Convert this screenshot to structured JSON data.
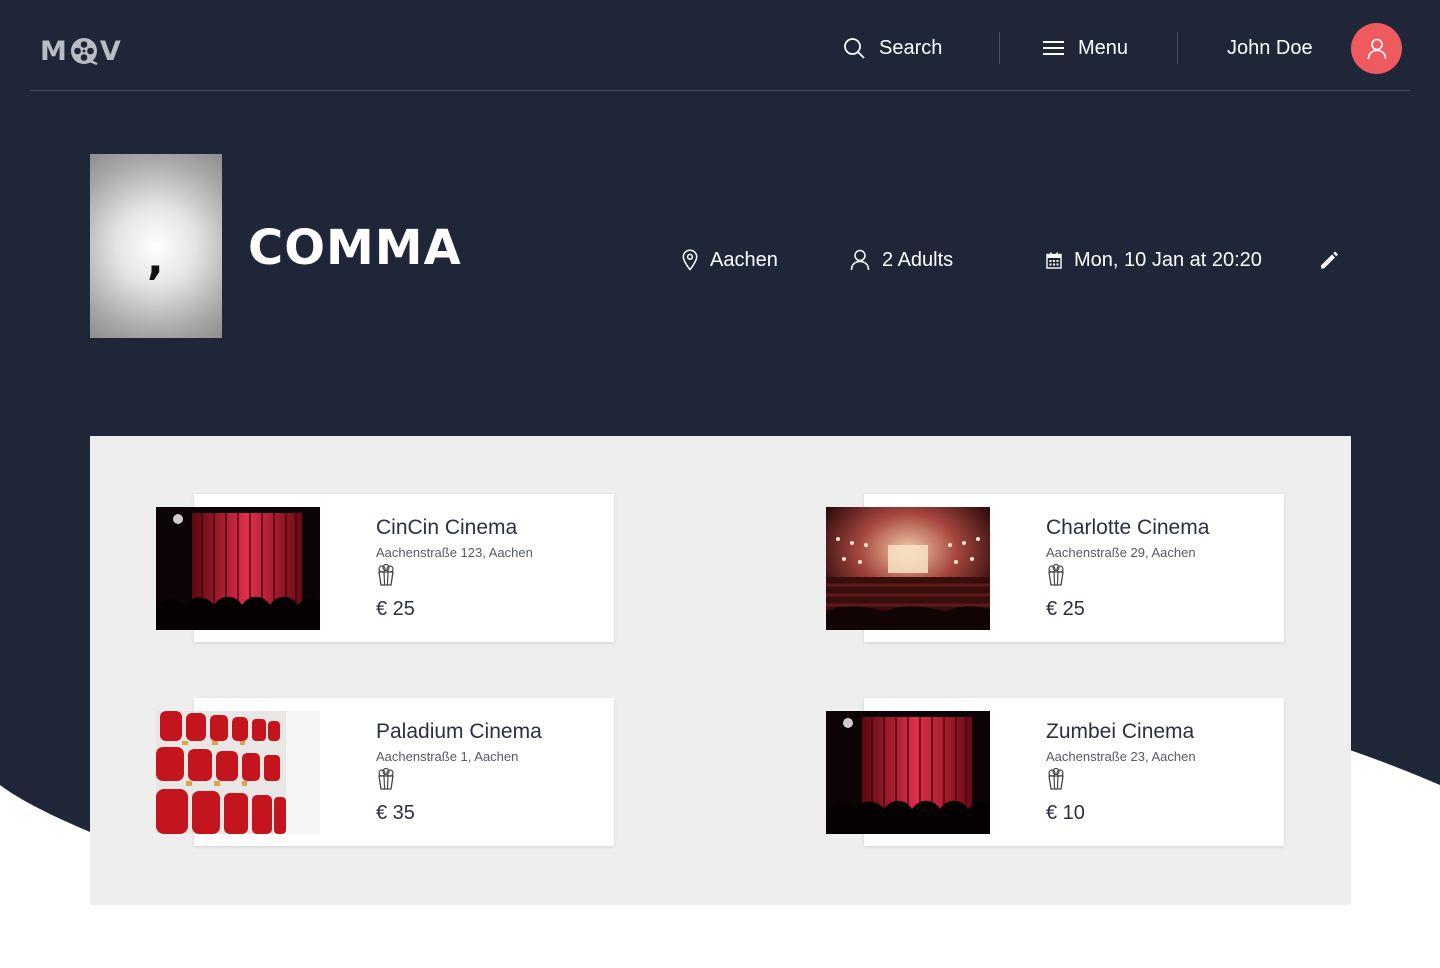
{
  "app": {
    "logo_text_left": "M",
    "logo_text_right": "V"
  },
  "header": {
    "search_label": "Search",
    "menu_label": "Menu",
    "user_name": "John Doe"
  },
  "colors": {
    "header_bg": "#1f2637",
    "accent": "#ee5a5e",
    "panel_bg": "#eeeeee",
    "card_bg": "#ffffff"
  },
  "movie": {
    "title": "COMMA",
    "poster_glyph": ",",
    "location": "Aachen",
    "guests": "2 Adults",
    "datetime": "Mon, 10 Jan at 20:20"
  },
  "icons": [
    "search-icon",
    "menu-icon",
    "user-icon",
    "location-pin-icon",
    "person-icon",
    "calendar-icon",
    "pencil-icon",
    "popcorn-icon"
  ],
  "cinemas": [
    {
      "name": "CinCin Cinema",
      "address": "Aachenstraße 123, Aachen",
      "price": "€ 25",
      "image": "red-curtain-stage"
    },
    {
      "name": "Charlotte Cinema",
      "address": "Aachenstraße 29, Aachen",
      "price": "€ 25",
      "image": "theater-hall"
    },
    {
      "name": "Paladium Cinema",
      "address": "Aachenstraße 1, Aachen",
      "price": "€ 35",
      "image": "red-seats"
    },
    {
      "name": "Zumbei Cinema",
      "address": "Aachenstraße 23, Aachen",
      "price": "€ 10",
      "image": "red-curtain-stage"
    }
  ]
}
